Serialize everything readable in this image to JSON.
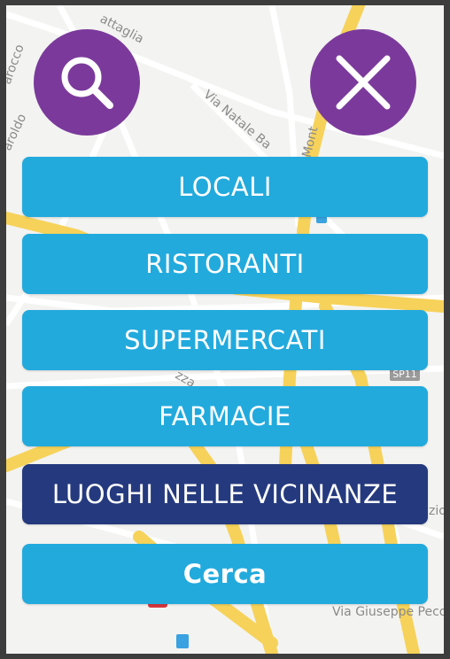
{
  "colors": {
    "accent_purple": "#7b3a9b",
    "button_blue": "#22aadd",
    "button_dark_navy": "#253a7e",
    "map_road_yellow": "#f6d25a",
    "map_background": "#f3f3f1"
  },
  "top_buttons": {
    "search_icon": "magnifier",
    "close_icon": "x"
  },
  "menu": {
    "locali": "LOCALI",
    "ristoranti": "RISTORANTI",
    "supermercati": "SUPERMERCATI",
    "farmacie": "FARMACIE",
    "luoghi": "LUOGHI NELLE VICINANZE",
    "cerca": "Cerca"
  },
  "map_labels": {
    "battaglia": "attaglia",
    "natale_ba": "Via Natale Ba",
    "monte": "e Mont",
    "barocco": "arocco",
    "aroldo": "aroldo",
    "sp11": "SP11",
    "zza": "zza",
    "peco": "Via Giuseppe Peco",
    "zio": "zio"
  }
}
